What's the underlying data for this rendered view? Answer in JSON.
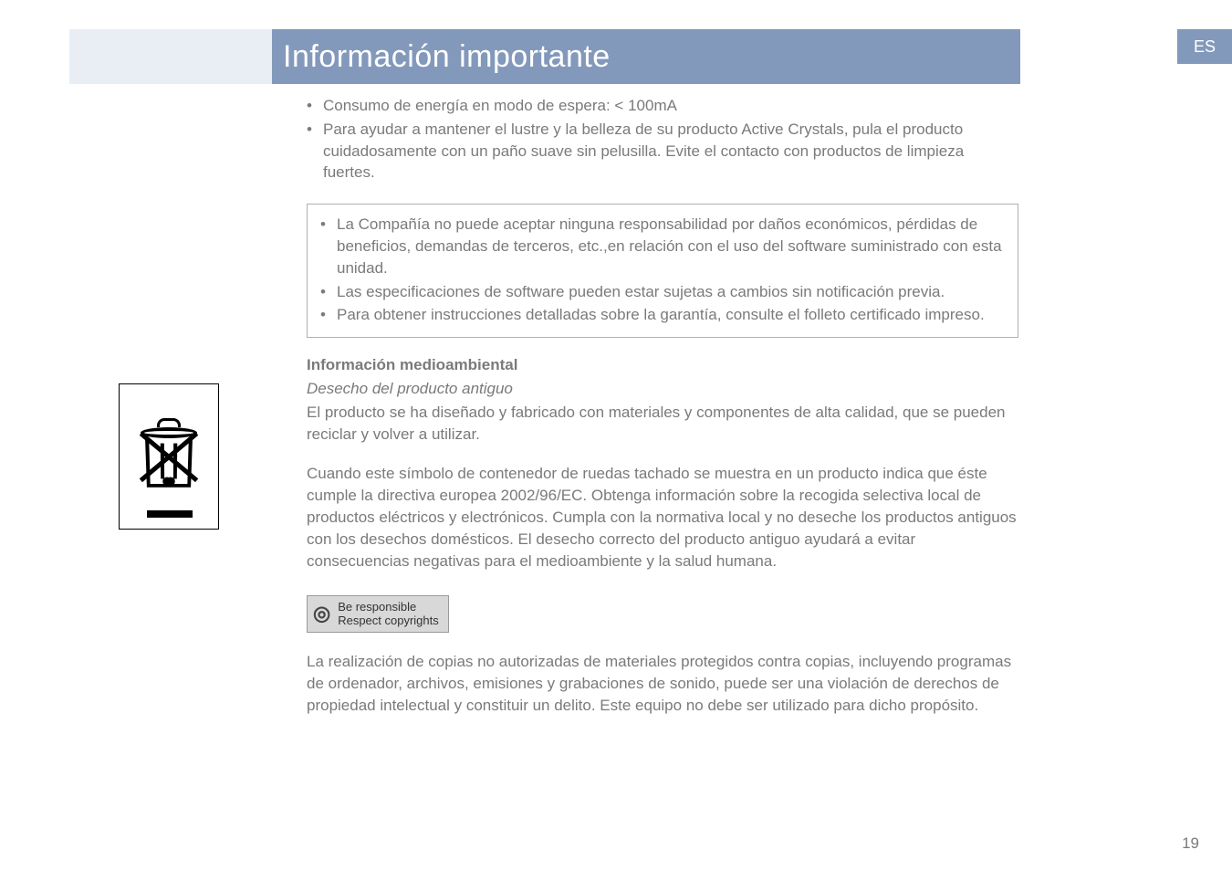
{
  "lang_code": "ES",
  "title": "Información importante",
  "top_bullets": [
    "Consumo de energía en modo de espera: < 100mA",
    "Para ayudar a mantener el lustre y la belleza de su producto Active Crystals, pula el producto cuidadosamente con un paño suave sin pelusilla. Evite el contacto con productos de limpieza fuertes."
  ],
  "boxed_bullets": [
    "La Compañía no puede aceptar ninguna responsabilidad por daños económicos, pérdidas de beneficios, demandas de terceros, etc.,en relación con el uso del software suministrado con esta unidad.",
    "Las especificaciones de software pueden estar sujetas a cambios sin notificación previa.",
    "Para obtener instrucciones detalladas sobre la garantía, consulte el folleto certificado impreso."
  ],
  "env_heading": "Información medioambiental",
  "env_subheading": "Desecho del producto antiguo",
  "env_intro": "El producto se ha diseñado y fabricado con materiales y componentes de alta calidad, que se pueden reciclar y volver a utilizar.",
  "weee_text": "Cuando este símbolo de contenedor de ruedas tachado se muestra en un producto indica que éste cumple la directiva europea 2002/96/EC. Obtenga información sobre la recogida selectiva local de productos eléctricos y electrónicos. Cumpla con la normativa local y no deseche los productos antiguos con los desechos domésticos. El desecho correcto del producto antiguo ayudará a evitar consecuencias negativas para el medioambiente y la salud humana.",
  "copyright_badge": {
    "line1": "Be responsible",
    "line2": "Respect copyrights"
  },
  "copyright_text": "La realización de copias no autorizadas de materiales protegidos contra copias, incluyendo programas de ordenador, archivos, emisiones y grabaciones de sonido, puede ser una violación de derechos de propiedad intelectual y constituir un delito. Este equipo no debe ser utilizado para dicho propósito.",
  "page_number": "19"
}
